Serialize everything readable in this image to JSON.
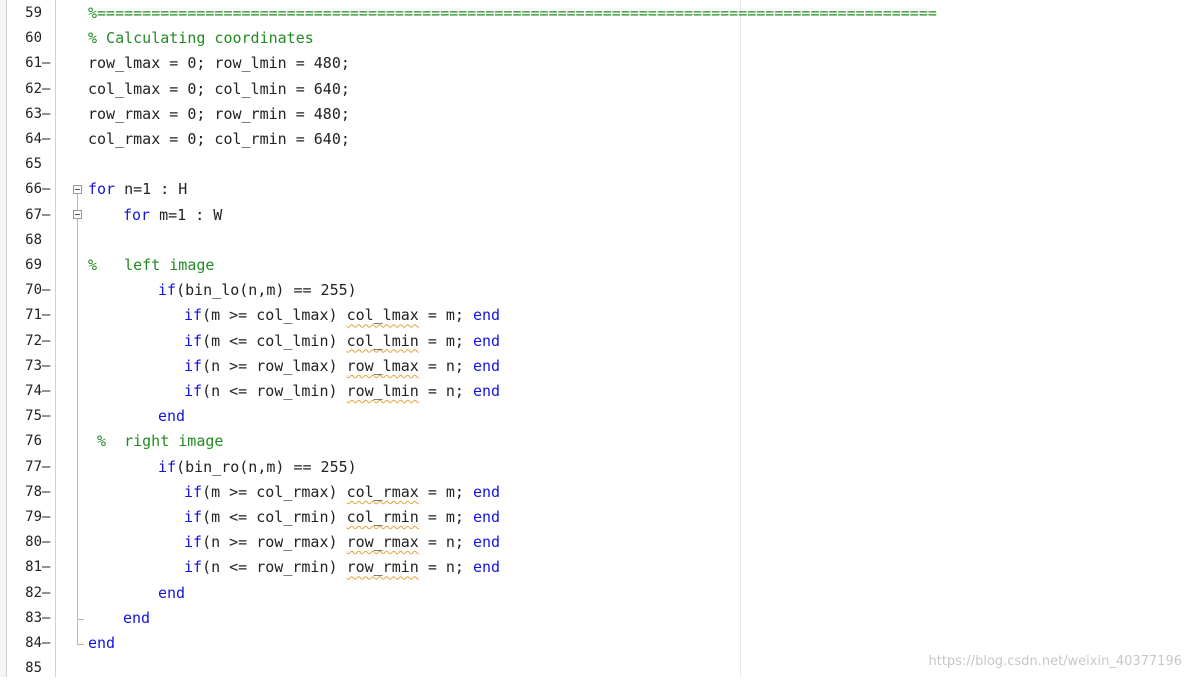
{
  "editor": {
    "lines": [
      {
        "num": "59",
        "dash": "",
        "indent": 88,
        "tokens": [
          {
            "t": "%=============================================================================================",
            "c": "cm"
          }
        ]
      },
      {
        "num": "60",
        "dash": "",
        "indent": 88,
        "tokens": [
          {
            "t": "% Calculating coordinates",
            "c": "cm"
          }
        ]
      },
      {
        "num": "61",
        "dash": "–",
        "indent": 88,
        "tokens": [
          {
            "t": "row_lmax = 0; row_lmin = 480;",
            "c": ""
          }
        ]
      },
      {
        "num": "62",
        "dash": "–",
        "indent": 88,
        "tokens": [
          {
            "t": "col_lmax = 0; col_lmin = 640;",
            "c": ""
          }
        ]
      },
      {
        "num": "63",
        "dash": "–",
        "indent": 88,
        "tokens": [
          {
            "t": "row_rmax = 0; row_rmin = 480;",
            "c": ""
          }
        ]
      },
      {
        "num": "64",
        "dash": "–",
        "indent": 88,
        "tokens": [
          {
            "t": "col_rmax = 0; col_rmin = 640;",
            "c": ""
          }
        ]
      },
      {
        "num": "65",
        "dash": "",
        "indent": 88,
        "tokens": []
      },
      {
        "num": "66",
        "dash": "–",
        "indent": 88,
        "tokens": [
          {
            "t": "for",
            "c": "kw"
          },
          {
            "t": " n=1 : H",
            "c": ""
          }
        ]
      },
      {
        "num": "67",
        "dash": "–",
        "indent": 123,
        "tokens": [
          {
            "t": "for",
            "c": "kw"
          },
          {
            "t": " m=1 : W",
            "c": ""
          }
        ]
      },
      {
        "num": "68",
        "dash": "",
        "indent": 88,
        "tokens": []
      },
      {
        "num": "69",
        "dash": "",
        "indent": 88,
        "tokens": [
          {
            "t": "%   left image",
            "c": "cm"
          }
        ]
      },
      {
        "num": "70",
        "dash": "–",
        "indent": 158,
        "tokens": [
          {
            "t": "if",
            "c": "kw"
          },
          {
            "t": "(bin_lo(n,m) == 255)",
            "c": ""
          }
        ]
      },
      {
        "num": "71",
        "dash": "–",
        "indent": 184,
        "tokens": [
          {
            "t": "if",
            "c": "kw"
          },
          {
            "t": "(m >= col_lmax) ",
            "c": ""
          },
          {
            "t": "col_lmax",
            "c": "sq"
          },
          {
            "t": " = m; ",
            "c": ""
          },
          {
            "t": "end",
            "c": "kw"
          }
        ]
      },
      {
        "num": "72",
        "dash": "–",
        "indent": 184,
        "tokens": [
          {
            "t": "if",
            "c": "kw"
          },
          {
            "t": "(m <= col_lmin) ",
            "c": ""
          },
          {
            "t": "col_lmin",
            "c": "sq"
          },
          {
            "t": " = m; ",
            "c": ""
          },
          {
            "t": "end",
            "c": "kw"
          }
        ]
      },
      {
        "num": "73",
        "dash": "–",
        "indent": 184,
        "tokens": [
          {
            "t": "if",
            "c": "kw"
          },
          {
            "t": "(n >= row_lmax) ",
            "c": ""
          },
          {
            "t": "row_lmax",
            "c": "sq"
          },
          {
            "t": " = n; ",
            "c": ""
          },
          {
            "t": "end",
            "c": "kw"
          }
        ]
      },
      {
        "num": "74",
        "dash": "–",
        "indent": 184,
        "tokens": [
          {
            "t": "if",
            "c": "kw"
          },
          {
            "t": "(n <= row_lmin) ",
            "c": ""
          },
          {
            "t": "row_lmin",
            "c": "sq"
          },
          {
            "t": " = n; ",
            "c": ""
          },
          {
            "t": "end",
            "c": "kw"
          }
        ]
      },
      {
        "num": "75",
        "dash": "–",
        "indent": 158,
        "tokens": [
          {
            "t": "end",
            "c": "kw"
          }
        ]
      },
      {
        "num": "76",
        "dash": "",
        "indent": 97,
        "tokens": [
          {
            "t": "%  right image",
            "c": "cm"
          }
        ]
      },
      {
        "num": "77",
        "dash": "–",
        "indent": 158,
        "tokens": [
          {
            "t": "if",
            "c": "kw"
          },
          {
            "t": "(bin_ro(n,m) == 255)",
            "c": ""
          }
        ]
      },
      {
        "num": "78",
        "dash": "–",
        "indent": 184,
        "tokens": [
          {
            "t": "if",
            "c": "kw"
          },
          {
            "t": "(m >= col_rmax) ",
            "c": ""
          },
          {
            "t": "col_rmax",
            "c": "sq"
          },
          {
            "t": " = m; ",
            "c": ""
          },
          {
            "t": "end",
            "c": "kw"
          }
        ]
      },
      {
        "num": "79",
        "dash": "–",
        "indent": 184,
        "tokens": [
          {
            "t": "if",
            "c": "kw"
          },
          {
            "t": "(m <= col_rmin) ",
            "c": ""
          },
          {
            "t": "col_rmin",
            "c": "sq"
          },
          {
            "t": " = m; ",
            "c": ""
          },
          {
            "t": "end",
            "c": "kw"
          }
        ]
      },
      {
        "num": "80",
        "dash": "–",
        "indent": 184,
        "tokens": [
          {
            "t": "if",
            "c": "kw"
          },
          {
            "t": "(n >= row_rmax) ",
            "c": ""
          },
          {
            "t": "row_rmax",
            "c": "sq"
          },
          {
            "t": " = n; ",
            "c": ""
          },
          {
            "t": "end",
            "c": "kw"
          }
        ]
      },
      {
        "num": "81",
        "dash": "–",
        "indent": 184,
        "tokens": [
          {
            "t": "if",
            "c": "kw"
          },
          {
            "t": "(n <= row_rmin) ",
            "c": ""
          },
          {
            "t": "row_rmin",
            "c": "sq"
          },
          {
            "t": " = n; ",
            "c": ""
          },
          {
            "t": "end",
            "c": "kw"
          }
        ]
      },
      {
        "num": "82",
        "dash": "–",
        "indent": 158,
        "tokens": [
          {
            "t": "end",
            "c": "kw"
          }
        ]
      },
      {
        "num": "83",
        "dash": "–",
        "indent": 123,
        "tokens": [
          {
            "t": "end",
            "c": "kw"
          }
        ]
      },
      {
        "num": "84",
        "dash": "–",
        "indent": 88,
        "tokens": [
          {
            "t": "end",
            "c": "kw"
          }
        ]
      },
      {
        "num": "85",
        "dash": "",
        "indent": 88,
        "tokens": []
      }
    ]
  },
  "colors": {
    "keyword": "#1414e0",
    "comment": "#228b22",
    "text": "#222222",
    "squiggle": "#e8a23a"
  },
  "fold_icons": [
    "minus-box-icon",
    "minus-box-icon"
  ],
  "watermark": "https://blog.csdn.net/weixin_40377196"
}
